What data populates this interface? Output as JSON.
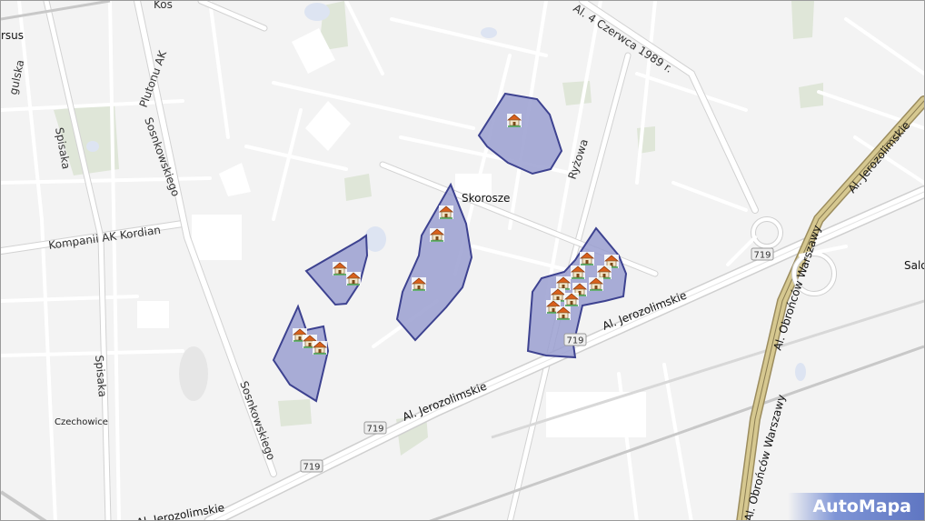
{
  "map": {
    "labels": {
      "ursus": "rsus",
      "skorosze": "Skorosze",
      "kompanii": "Kompanii AK Kordian",
      "czerwca": "Al. 4 Czerwca 1989 r.",
      "plutonu": "Plutonu AK",
      "kosc": "Kos",
      "sosnkowskiego_top": "Sosnkowskiego",
      "sosnkowskiego_bottom": "Sosnkowskiego",
      "spisaka_top": "Spisaka",
      "spisaka_bottom": "Spisaka",
      "czechowice": "Czechowice",
      "ryzowa": "Ryżowa",
      "jerozolimskie_mid": "Al. Jerozolimskie",
      "jerozolimskie_right": "Al. Jerozolimskie",
      "jerozolimskie_bottom": "Al. Jerozolimskie",
      "obroncow_top": "Al. Obrońców Warszawy",
      "obroncow_bottom": "Al. Obrońców Warszawy",
      "al_jerozolimskie_ne": "Al. Jerozolimskie",
      "salo": "Salo",
      "gulska": "gulska"
    },
    "road_shields": [
      "719",
      "719",
      "719",
      "719"
    ],
    "logo": "AutoMapa",
    "colors": {
      "background": "#f3f3f3",
      "road": "#ffffff",
      "road_edge": "#d2d2d2",
      "expressway": "#c9b98a",
      "green": "#dfe6d8",
      "water": "#dde4f2",
      "area_fill": "#9a9fd0",
      "area_stroke": "#3d4290",
      "rail": "#c8c8c8"
    },
    "marker_icon": "house-icon"
  }
}
